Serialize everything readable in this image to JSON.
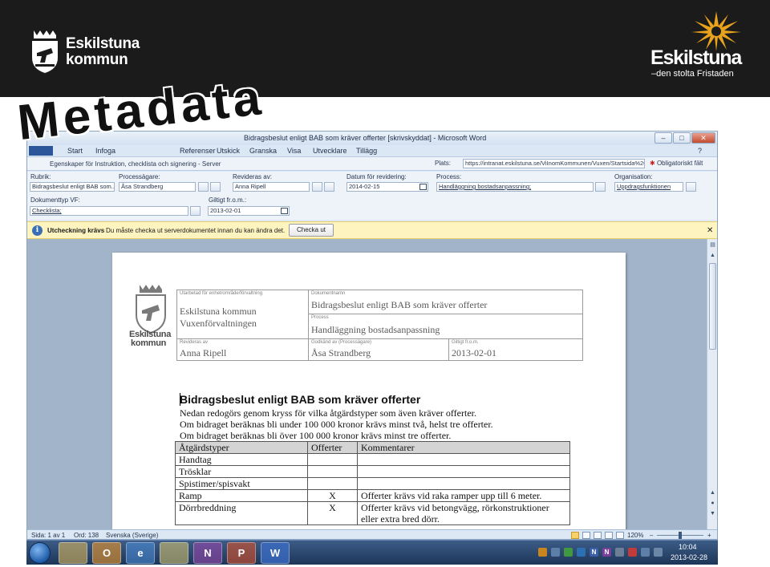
{
  "banner": {
    "left_logo": {
      "line1": "Eskilstuna",
      "line2": "kommun"
    },
    "right_logo": {
      "name": "Eskilstuna",
      "slogan": "–den stolta Fristaden"
    }
  },
  "overlay_title": "Metadata",
  "window": {
    "title": "Bidragsbeslut enligt BAB som kräver offerter [skrivskyddat] - Microsoft Word",
    "controls": {
      "minimize": "–",
      "maximize": "□",
      "close": "✕"
    },
    "tabs": [
      "Arkiv",
      "Start",
      "Infoga",
      "Referenser",
      "Utskick",
      "Granska",
      "Visa",
      "Utvecklare",
      "Tillägg"
    ]
  },
  "docinfo": {
    "title": "Egenskaper för Instruktion, checklista och signering - Server",
    "location_label": "Plats:",
    "location_value": "https://intranat.eskilstuna.se/ViInomKommunen/Vuxen/Startsida%20",
    "required_note": "Obligatoriskt fält"
  },
  "fields": {
    "rubrik": {
      "label": "Rubrik:",
      "value": "Bidragsbeslut enligt BAB som..."
    },
    "processagare": {
      "label": "Processägare:",
      "value": "Åsa Strandberg"
    },
    "revideras_av": {
      "label": "Revideras av:",
      "value": "Anna Ripell"
    },
    "datum_revidering": {
      "label": "Datum för revidering:",
      "value": "2014-02-15"
    },
    "process": {
      "label": "Process:",
      "value": "Handläggning bostadsanpassning;"
    },
    "organisation": {
      "label": "Organisation:",
      "value": "Uppdragsfunktionen"
    },
    "dokumenttyp": {
      "label": "Dokumenttyp VF:",
      "value": "Checklista;"
    },
    "giltigt": {
      "label": "Giltigt fr.o.m.:",
      "value": "2013-02-01"
    }
  },
  "message_bar": {
    "icon": "i",
    "title": "Utcheckning krävs",
    "text": "Du måste checka ut serverdokumentet innan du kan ändra det.",
    "button": "Checka ut",
    "close": "✕"
  },
  "document": {
    "logo": {
      "line1": "Eskilstuna",
      "line2": "kommun"
    },
    "meta": {
      "unit_label": "Utarbetad för enhet/område/förvaltning",
      "unit_value1": "Eskilstuna kommun",
      "unit_value2": "Vuxenförvaltningen",
      "docname_label": "Dokumentnamn",
      "docname_value": "Bidragsbeslut enligt BAB som kräver offerter",
      "process_label": "Process",
      "process_value": "Handläggning bostadsanpassning",
      "revised_label": "Revideras av",
      "revised_value": "Anna Ripell",
      "approved_label": "Godkänd av (Processägare)",
      "approved_value": "Åsa Strandberg",
      "valid_label": "Giltigt fr.o.m.",
      "valid_value": "2013-02-01"
    },
    "heading": "Bidragsbeslut enligt BAB som kräver offerter",
    "paragraphs": [
      "Nedan redogörs genom kryss för vilka åtgärdstyper som även kräver offerter.",
      "Om bidraget beräknas bli under 100 000 kronor krävs minst två, helst tre offerter.",
      "Om bidraget beräknas bli över 100 000 kronor krävs minst tre offerter."
    ],
    "table": {
      "headers": [
        "Åtgärdstyper",
        "Offerter",
        "Kommentarer"
      ],
      "rows": [
        {
          "type": "Handtag",
          "offer": "",
          "comment": ""
        },
        {
          "type": "Trösklar",
          "offer": "",
          "comment": ""
        },
        {
          "type": "Spistimer/spisvakt",
          "offer": "",
          "comment": ""
        },
        {
          "type": "Ramp",
          "offer": "X",
          "comment": "Offerter krävs vid raka ramper upp till 6 meter."
        },
        {
          "type": "Dörrbreddning",
          "offer": "X",
          "comment": "Offerter krävs vid betongvägg, rörkonstruktioner",
          "comment2": "eller extra bred dörr."
        }
      ]
    }
  },
  "statusbar": {
    "page": "Sida: 1 av 1",
    "words": "Ord: 138",
    "language": "Svenska (Sverige)",
    "zoom": "120%",
    "zoom_minus": "–",
    "zoom_plus": "+"
  },
  "taskbar": {
    "apps": [
      {
        "name": "explorer",
        "glyph": ""
      },
      {
        "name": "outlook",
        "glyph": "O"
      },
      {
        "name": "internet-explorer",
        "glyph": "e"
      },
      {
        "name": "folder",
        "glyph": ""
      },
      {
        "name": "onenote",
        "glyph": "N"
      },
      {
        "name": "powerpoint",
        "glyph": "P"
      },
      {
        "name": "word",
        "glyph": "W"
      }
    ],
    "time": "10:04",
    "date": "2013-02-28"
  },
  "colors": {
    "banner": "#1b1b1b",
    "ribbon_blue": "#2b579a",
    "message_bar": "#fdf4c0",
    "logo_star_gold": "#e8a21c"
  }
}
